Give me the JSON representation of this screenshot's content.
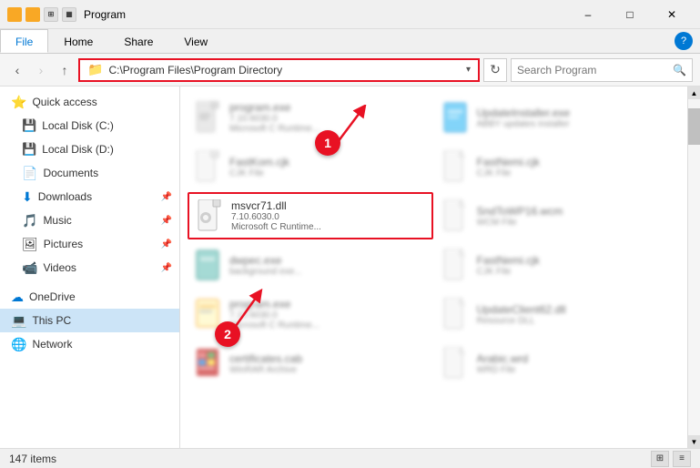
{
  "titleBar": {
    "title": "Program",
    "minimizeLabel": "–",
    "maximizeLabel": "□",
    "closeLabel": "✕"
  },
  "ribbon": {
    "tabs": [
      "File",
      "Home",
      "Share",
      "View"
    ],
    "activeTab": "Home",
    "helpBtn": "?"
  },
  "addressBar": {
    "backBtn": "‹",
    "forwardBtn": "›",
    "upBtn": "↑",
    "path": "C:\\Program Files\\Program Directory",
    "refreshBtn": "↻",
    "searchPlaceholder": "Search Program"
  },
  "sidebar": {
    "items": [
      {
        "label": "Quick access",
        "icon": "⭐",
        "indented": false
      },
      {
        "label": "Local Disk (C:)",
        "icon": "💾",
        "indented": true
      },
      {
        "label": "Local Disk (D:)",
        "icon": "💾",
        "indented": true
      },
      {
        "label": "Documents",
        "icon": "📁",
        "indented": true,
        "pin": true
      },
      {
        "label": "Downloads",
        "icon": "⬇",
        "indented": true,
        "pin": true
      },
      {
        "label": "Music",
        "icon": "🎵",
        "indented": true,
        "pin": true
      },
      {
        "label": "Pictures",
        "icon": "🖼",
        "indented": true,
        "pin": true
      },
      {
        "label": "Videos",
        "icon": "📹",
        "indented": true,
        "pin": true
      },
      {
        "label": "OneDrive",
        "icon": "☁",
        "indented": false
      },
      {
        "label": "This PC",
        "icon": "💻",
        "indented": false,
        "active": true
      },
      {
        "label": "Network",
        "icon": "🌐",
        "indented": false
      }
    ]
  },
  "files": [
    {
      "name": "program.exe",
      "detail": "7.10.6030.0",
      "type": "Microsoft C Runtime...",
      "blurred": true,
      "highlighted": false,
      "iconType": "exe"
    },
    {
      "name": "UpdateInstaller.exe",
      "detail": "ABBY updates installer",
      "type": "",
      "blurred": true,
      "highlighted": false,
      "iconType": "exe-blue"
    },
    {
      "name": "FastKom.cjk",
      "detail": "",
      "type": "CJK File",
      "blurred": true,
      "highlighted": false,
      "iconType": "generic"
    },
    {
      "name": "FastNemi.cjk",
      "detail": "",
      "type": "CJK File",
      "blurred": true,
      "highlighted": false,
      "iconType": "generic"
    },
    {
      "name": "msvcr71.dll",
      "detail": "7.10.6030.0",
      "type": "Microsoft C Runtime...",
      "blurred": false,
      "highlighted": true,
      "iconType": "dll"
    },
    {
      "name": "SndToWP16.wcm",
      "detail": "",
      "type": "WCM File",
      "blurred": true,
      "highlighted": false,
      "iconType": "generic"
    },
    {
      "name": "dwpec.exe",
      "detail": "background exe...",
      "type": "",
      "blurred": true,
      "highlighted": false,
      "iconType": "exe-teal"
    },
    {
      "name": "FastNemi.cjk",
      "detail": "",
      "type": "CJK File",
      "blurred": true,
      "highlighted": false,
      "iconType": "generic"
    },
    {
      "name": "program.exe",
      "detail": "7.10.6030.0",
      "type": "Microsoft C Runtime...",
      "blurred": true,
      "highlighted": false,
      "iconType": "exe-yellow"
    },
    {
      "name": "UpdateClient62.dll",
      "detail": "",
      "type": "Resource DLL",
      "blurred": true,
      "highlighted": false,
      "iconType": "generic"
    },
    {
      "name": "certificates.cab",
      "detail": "",
      "type": "WinRAR Archive",
      "blurred": true,
      "highlighted": false,
      "iconType": "cab"
    },
    {
      "name": "Arabic.wrd",
      "detail": "",
      "type": "WRD File",
      "blurred": true,
      "highlighted": false,
      "iconType": "generic"
    }
  ],
  "statusBar": {
    "itemCount": "147 items"
  },
  "annotations": [
    {
      "id": "1",
      "label": "1"
    },
    {
      "id": "2",
      "label": "2"
    }
  ]
}
